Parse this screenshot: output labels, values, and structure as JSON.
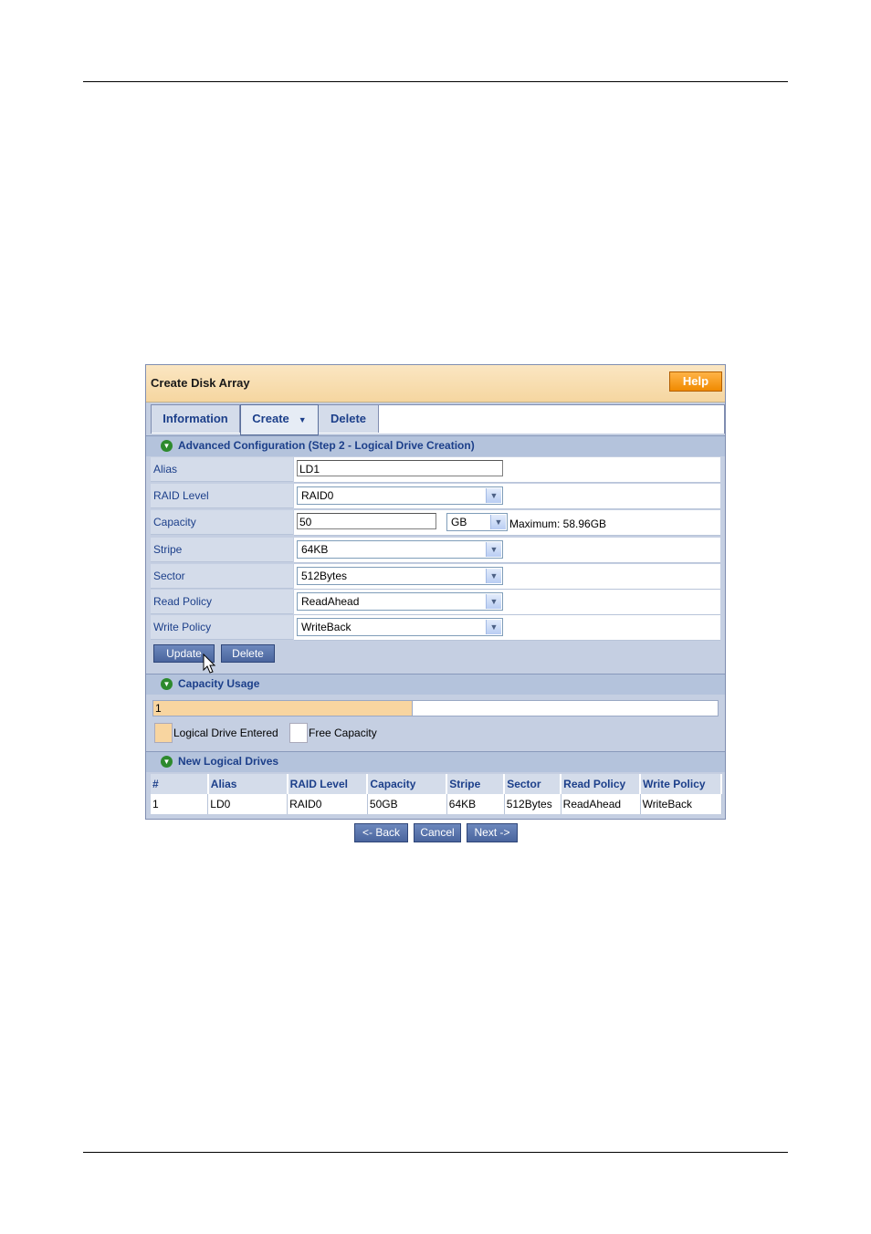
{
  "window": {
    "title": "Create Disk Array",
    "help_label": "Help"
  },
  "tabs": [
    {
      "label": "Information"
    },
    {
      "label": "Create"
    },
    {
      "label": "Delete"
    }
  ],
  "advanced": {
    "header": "Advanced Configuration (Step 2 - Logical Drive Creation)",
    "alias": {
      "label": "Alias",
      "value": "LD1"
    },
    "raid_level": {
      "label": "RAID Level",
      "value": "RAID0"
    },
    "capacity": {
      "label": "Capacity",
      "value": "50",
      "unit": "GB",
      "maximum": "Maximum: 58.96GB"
    },
    "stripe": {
      "label": "Stripe",
      "value": "64KB"
    },
    "sector": {
      "label": "Sector",
      "value": "512Bytes"
    },
    "read_policy": {
      "label": "Read Policy",
      "value": "ReadAhead"
    },
    "write_policy": {
      "label": "Write Policy",
      "value": "WriteBack"
    },
    "update_label": "Update",
    "delete_label": "Delete"
  },
  "capacity_usage": {
    "header": "Capacity Usage",
    "bar_label": "1",
    "used_fraction": 0.46,
    "legend_entered": "Logical Drive Entered",
    "legend_free": "Free Capacity",
    "color_entered": "#f8d5a0",
    "color_free": "#ffffff"
  },
  "new_logical_drives": {
    "header": "New Logical Drives",
    "columns": [
      "#",
      "Alias",
      "RAID Level",
      "Capacity",
      "Stripe",
      "Sector",
      "Read Policy",
      "Write Policy"
    ],
    "rows": [
      [
        "1",
        "LD0",
        "RAID0",
        "50GB",
        "64KB",
        "512Bytes",
        "ReadAhead",
        "WriteBack"
      ]
    ]
  },
  "nav": {
    "back_label": "<- Back",
    "cancel_label": "Cancel",
    "next_label": "Next ->"
  },
  "icons": {
    "section_toggle": "chevron-down-circle-icon",
    "dropdown": "chevron-down-icon",
    "cursor": "mouse-pointer-icon"
  }
}
